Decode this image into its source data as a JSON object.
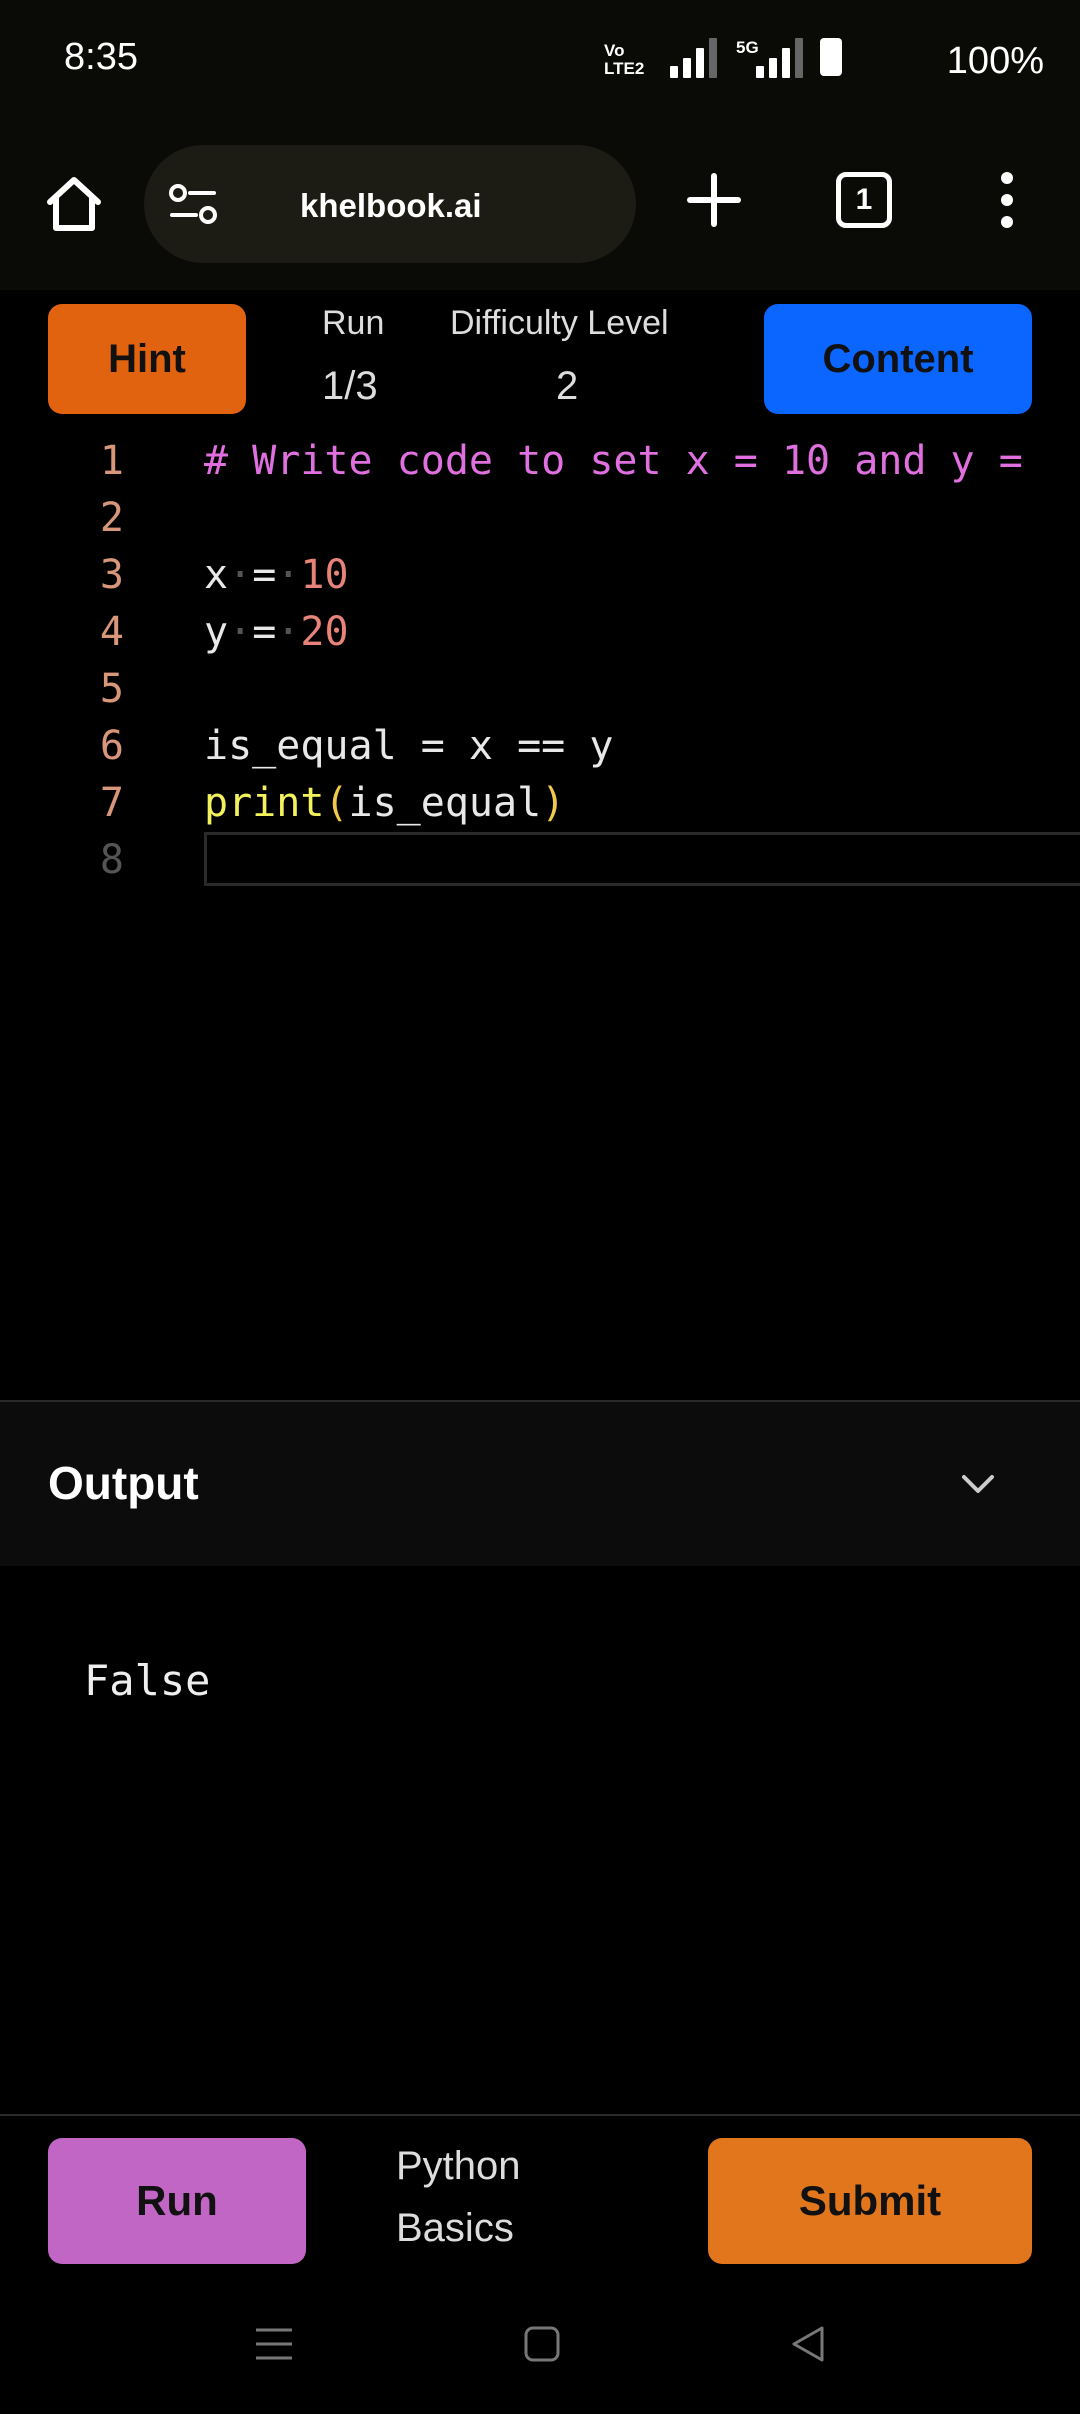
{
  "status_bar": {
    "time": "8:35",
    "volte_label": "Vo LTE2",
    "network_label": "5G",
    "battery": "100%"
  },
  "browser": {
    "url": "khelbook.ai",
    "tab_count": "1"
  },
  "toolbar": {
    "hint_label": "Hint",
    "run_label": "Run",
    "run_count": "1/3",
    "difficulty_label": "Difficulty Level",
    "difficulty_value": "2",
    "content_label": "Content"
  },
  "editor": {
    "line_numbers": [
      "1",
      "2",
      "3",
      "4",
      "5",
      "6",
      "7",
      "8"
    ],
    "line1_comment": "# Write code to set x = 10 and y =",
    "line3_var": "x",
    "line3_num": "10",
    "line4_var": "y",
    "line4_num": "20",
    "line6": "is_equal = x == y",
    "line7_fn": "print",
    "line7_arg": "is_equal"
  },
  "output": {
    "title": "Output",
    "text": "False"
  },
  "bottom_bar": {
    "run_label": "Run",
    "course_line1": "Python",
    "course_line2": "Basics",
    "submit_label": "Submit"
  }
}
